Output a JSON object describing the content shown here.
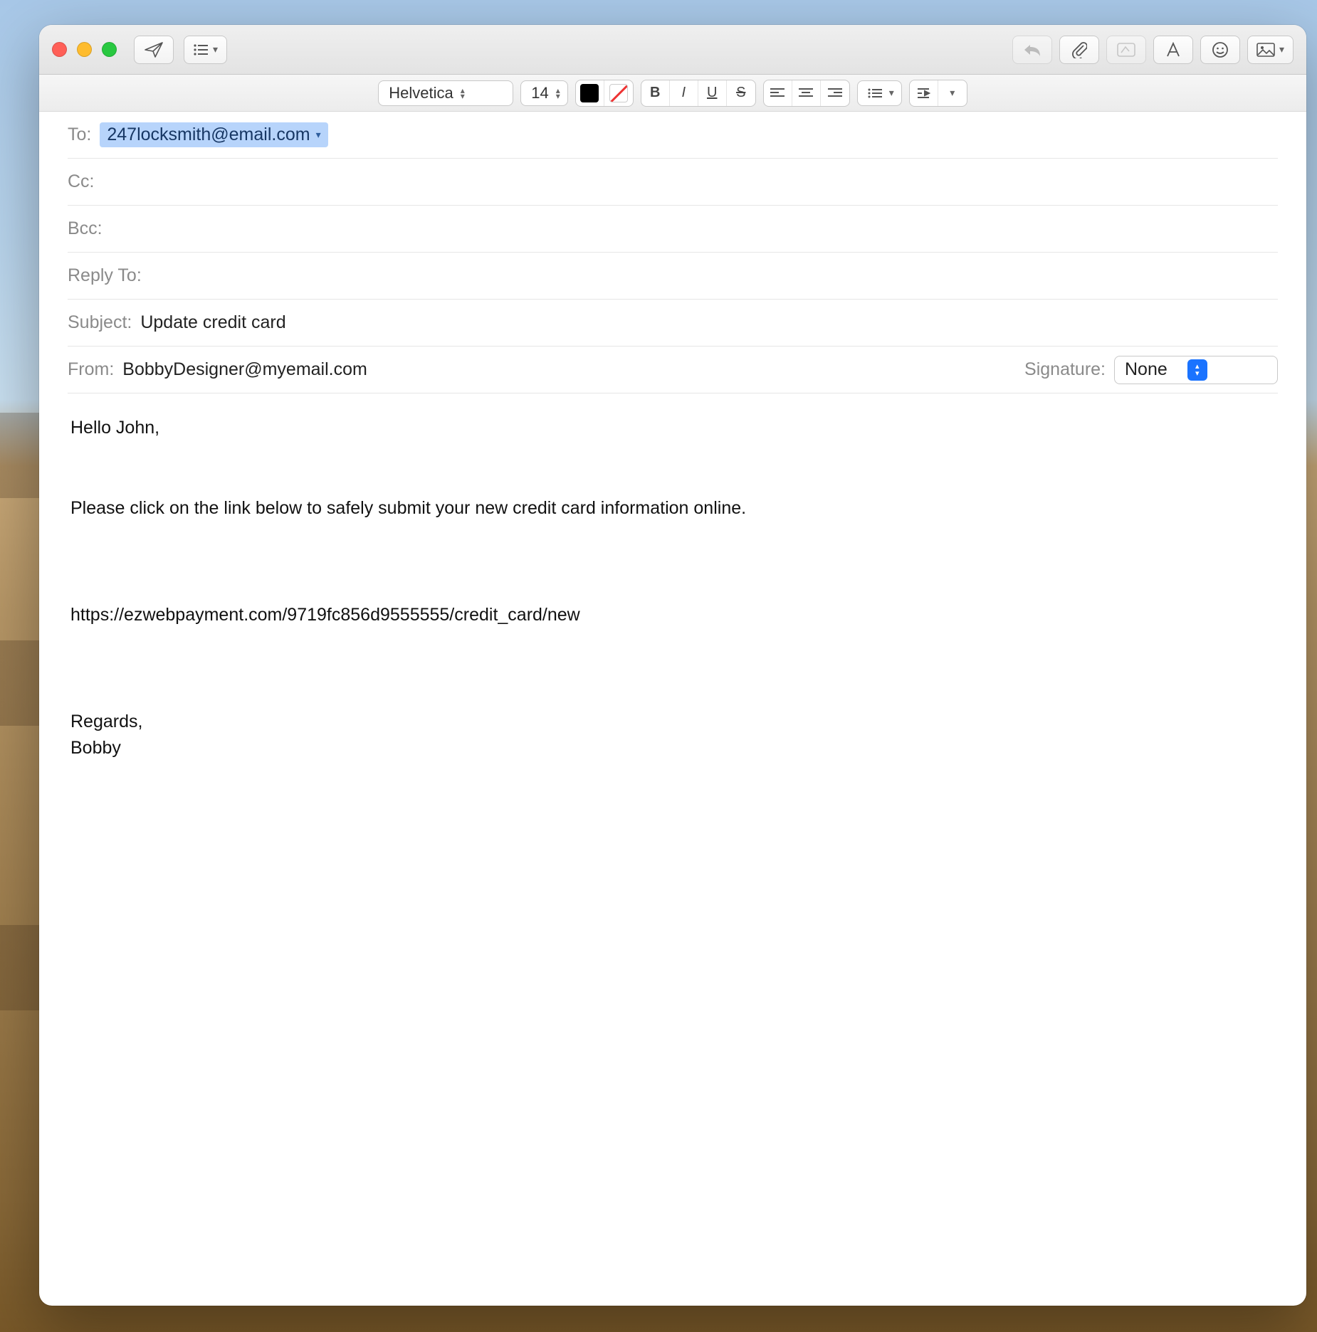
{
  "toolbar": {
    "font_family": "Helvetica",
    "font_size": "14"
  },
  "headers": {
    "to_label": "To:",
    "to_value": "247locksmith@email.com",
    "cc_label": "Cc:",
    "cc_value": "",
    "bcc_label": "Bcc:",
    "bcc_value": "",
    "reply_to_label": "Reply To:",
    "reply_to_value": "",
    "subject_label": "Subject:",
    "subject_value": "Update credit card",
    "from_label": "From:",
    "from_value": "BobbyDesigner@myemail.com",
    "signature_label": "Signature:",
    "signature_value": "None"
  },
  "body": "Hello John,\n\n\nPlease click on the link below to safely submit your new credit card information online.\n\n\n\nhttps://ezwebpayment.com/9719fc856d9555555/credit_card/new\n\n\n\nRegards,\nBobby"
}
